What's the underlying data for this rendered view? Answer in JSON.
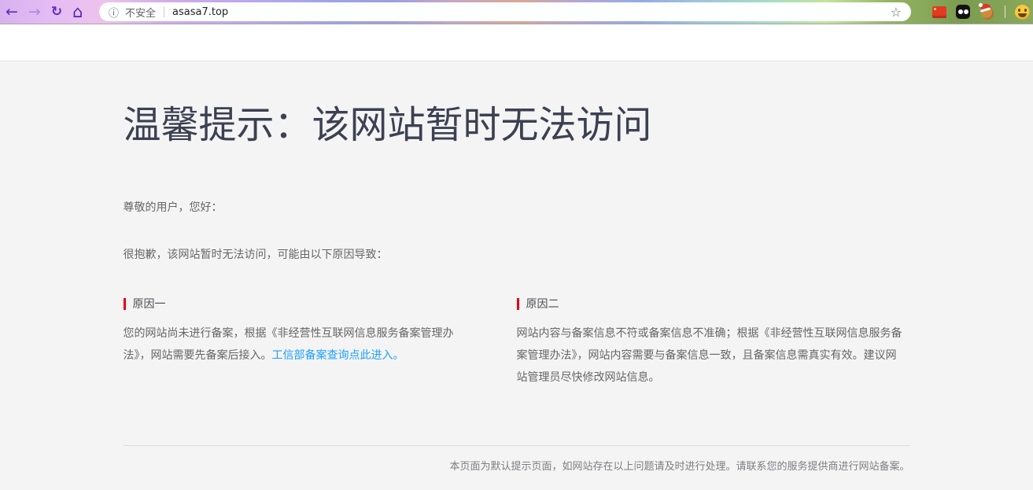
{
  "browser": {
    "nav": {
      "back_icon": "←",
      "forward_icon": "→",
      "reload_icon": "↻",
      "home_icon": "⌂"
    },
    "address_bar": {
      "info_icon": "ⓘ",
      "security_label": "不安全",
      "url": "asasa7.top",
      "bookmark_icon": "☆"
    },
    "extensions": {
      "flag": "china-flag-icon",
      "dark_box": "dark-box-eyes-icon",
      "santa": "santa-emoji-icon",
      "profile": "smiley-face-icon"
    }
  },
  "page": {
    "title": "温馨提示：该网站暂时无法访问",
    "greeting": "尊敬的用户，您好：",
    "intro": "很抱歉，该网站暂时无法访问，可能由以下原因导致：",
    "reasons": [
      {
        "label": "原因一",
        "text": "您的网站尚未进行备案，根据《非经营性互联网信息服务备案管理办法》，网站需要先备案后接入。",
        "link": "工信部备案查询点此进入。"
      },
      {
        "label": "原因二",
        "text": "网站内容与备案信息不符或备案信息不准确；根据《非经营性互联网信息服务备案管理办法》，网站内容需要与备案信息一致，且备案信息需真实有效。建议网站管理员尽快修改网站信息。"
      }
    ],
    "footer": "本页面为默认提示页面，如网站存在以上问题请及时进行处理。请联系您的服务提供商进行网站备案。"
  },
  "colors": {
    "accent_link": "#1e9fff",
    "reason_marker": "#e60012",
    "title_text": "#3b4152",
    "page_bg": "#f4f4f5"
  }
}
